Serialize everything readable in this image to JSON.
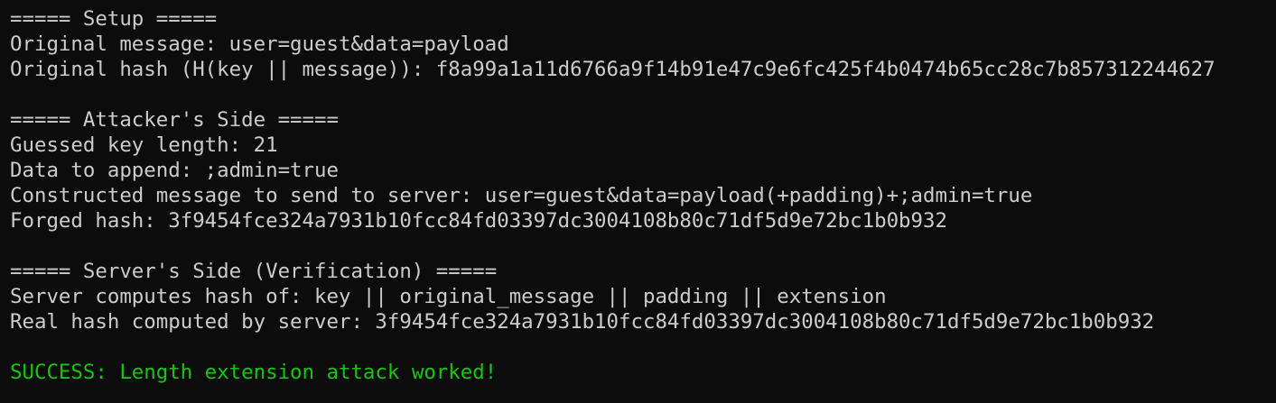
{
  "terminal": {
    "colors": {
      "background": "#0c0c0c",
      "text": "#cccccc",
      "success": "#16c60c"
    },
    "setup": {
      "header": "===== Setup =====",
      "original_message": "Original message: user=guest&data=payload",
      "original_hash": "Original hash (H(key || message)): f8a99a1a11d6766a9f14b91e47c9e6fc425f4b0474b65cc28c7b857312244627"
    },
    "attacker": {
      "header": "===== Attacker's Side =====",
      "guessed_key_length": "Guessed key length: 21",
      "data_to_append": "Data to append: ;admin=true",
      "constructed_message": "Constructed message to send to server: user=guest&data=payload(+padding)+;admin=true",
      "forged_hash": "Forged hash: 3f9454fce324a7931b10fcc84fd03397dc3004108b80c71df5d9e72bc1b0b932"
    },
    "server": {
      "header": "===== Server's Side (Verification) =====",
      "computes_hash_of": "Server computes hash of: key || original_message || padding || extension",
      "real_hash": "Real hash computed by server: 3f9454fce324a7931b10fcc84fd03397dc3004108b80c71df5d9e72bc1b0b932"
    },
    "result": "SUCCESS: Length extension attack worked!"
  }
}
